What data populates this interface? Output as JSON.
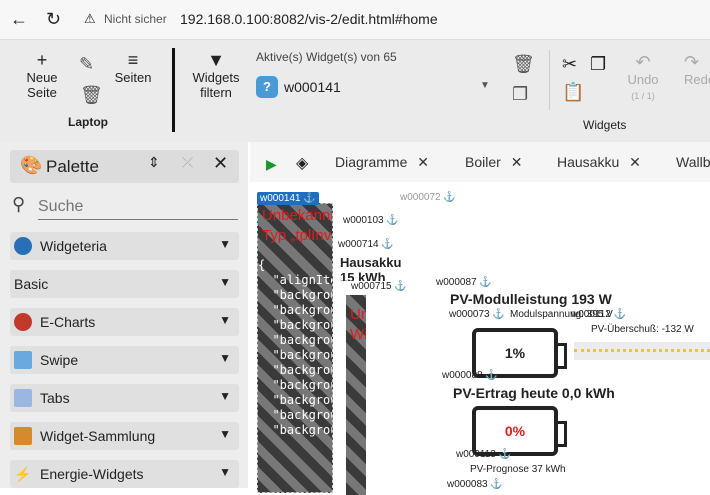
{
  "browser": {
    "security": "Nicht sicher",
    "url": "192.168.0.100:8082/vis-2/edit.html#home"
  },
  "toolbar": {
    "new_page": "Neue Seite",
    "pages": "Seiten",
    "group_view": "Laptop",
    "filter": "Widgets filtern",
    "active_label": "Aktive(s) Widget(s) von 65",
    "selected_widget": "w000141",
    "undo": "Undo",
    "undo_count": "(1 / 1)",
    "redo": "Redo",
    "group_widgets": "Widgets"
  },
  "palette": {
    "title": "Palette",
    "search_placeholder": "Suche",
    "items": [
      {
        "label": "Widgeteria"
      },
      {
        "label": "Basic"
      },
      {
        "label": "E-Charts"
      },
      {
        "label": "Swipe"
      },
      {
        "label": "Tabs"
      },
      {
        "label": "Widget-Sammlung"
      },
      {
        "label": "Energie-Widgets"
      }
    ]
  },
  "tabs": [
    {
      "label": "Diagramme"
    },
    {
      "label": "Boiler"
    },
    {
      "label": "Hausakku"
    },
    {
      "label": "Wallbox"
    }
  ],
  "canvas": {
    "w141": "w000141 ⚓",
    "w072": "w000072 ⚓",
    "w103": "w000103 ⚓",
    "w714": "w000714 ⚓",
    "w715": "w000715 ⚓",
    "w087": "w000087 ⚓",
    "w112": "w000112 ⚓",
    "w088": "w000088 ⚓",
    "w113": "w000113 ⚓",
    "w083": "w000083 ⚓",
    "w0xx": "w000073 ⚓",
    "unknown1": "Unbekannter Widget-Typ „tplInventory“",
    "unknown2": "Unbekannter Widget-Typ „",
    "code_lines": [
      "{",
      "  \"alignItems\"",
      "  \"background\"",
      "  \"background\"",
      "  \"background\"",
      "  \"background\"",
      "  \"background\"",
      "  \"background\"",
      "  \"background\"",
      "  \"background\"",
      "  \"background\"",
      "  \"background\""
    ],
    "hausakku": "Hausakku 15 kWh",
    "pv_power": "PV-Modulleistung 193 W",
    "pv_voltage": "Modulspannung: 395 V",
    "pv_surplus": "PV-Überschuß: -132 W",
    "batt1": "1%",
    "pv_yield": "PV-Ertrag heute 0,0 kWh",
    "batt2": "0%",
    "forecast": "PV-Prognose 37 kWh"
  }
}
